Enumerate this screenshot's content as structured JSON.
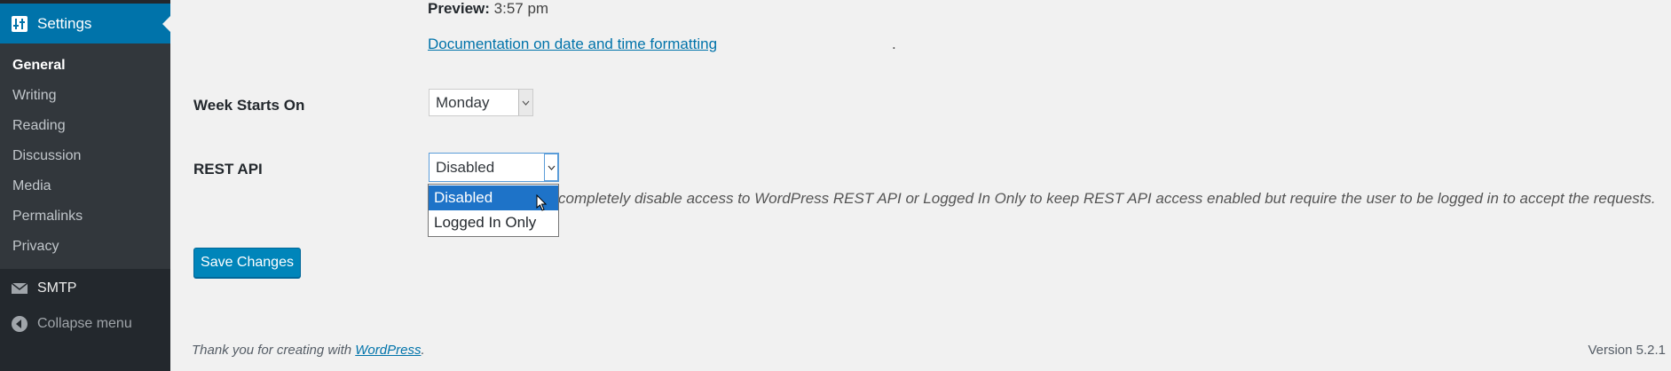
{
  "sidebar": {
    "current_menu": {
      "label": "Settings",
      "icon": "settings-icon"
    },
    "submenu": [
      {
        "label": "General",
        "current": true
      },
      {
        "label": "Writing"
      },
      {
        "label": "Reading"
      },
      {
        "label": "Discussion"
      },
      {
        "label": "Media"
      },
      {
        "label": "Permalinks"
      },
      {
        "label": "Privacy"
      }
    ],
    "smtp": {
      "label": "SMTP",
      "icon": "envelope-icon"
    },
    "collapse": {
      "label": "Collapse menu",
      "icon": "collapse-arrow-icon"
    }
  },
  "main": {
    "preview": {
      "label": "Preview:",
      "value": "3:57 pm"
    },
    "doc_link": "Documentation on date and time formatting",
    "week_starts_on": {
      "label": "Week Starts On",
      "value": "Monday"
    },
    "rest_api": {
      "label": "REST API",
      "value": "Disabled",
      "options": [
        "Disabled",
        "Logged In Only"
      ],
      "description": "completely disable access to WordPress REST API or Logged In Only to keep REST API access enabled but require the user to be logged in to accept the requests."
    },
    "save_button": "Save Changes"
  },
  "footer": {
    "thanks_prefix": "Thank you for creating with ",
    "wordpress_link": "WordPress",
    "thanks_suffix": ".",
    "version": "Version 5.2.1"
  },
  "colors": {
    "sidebar_bg": "#23282d",
    "submenu_bg": "#32373c",
    "accent": "#0073aa",
    "button": "#0085ba",
    "selected_option": "#1e73c8"
  }
}
